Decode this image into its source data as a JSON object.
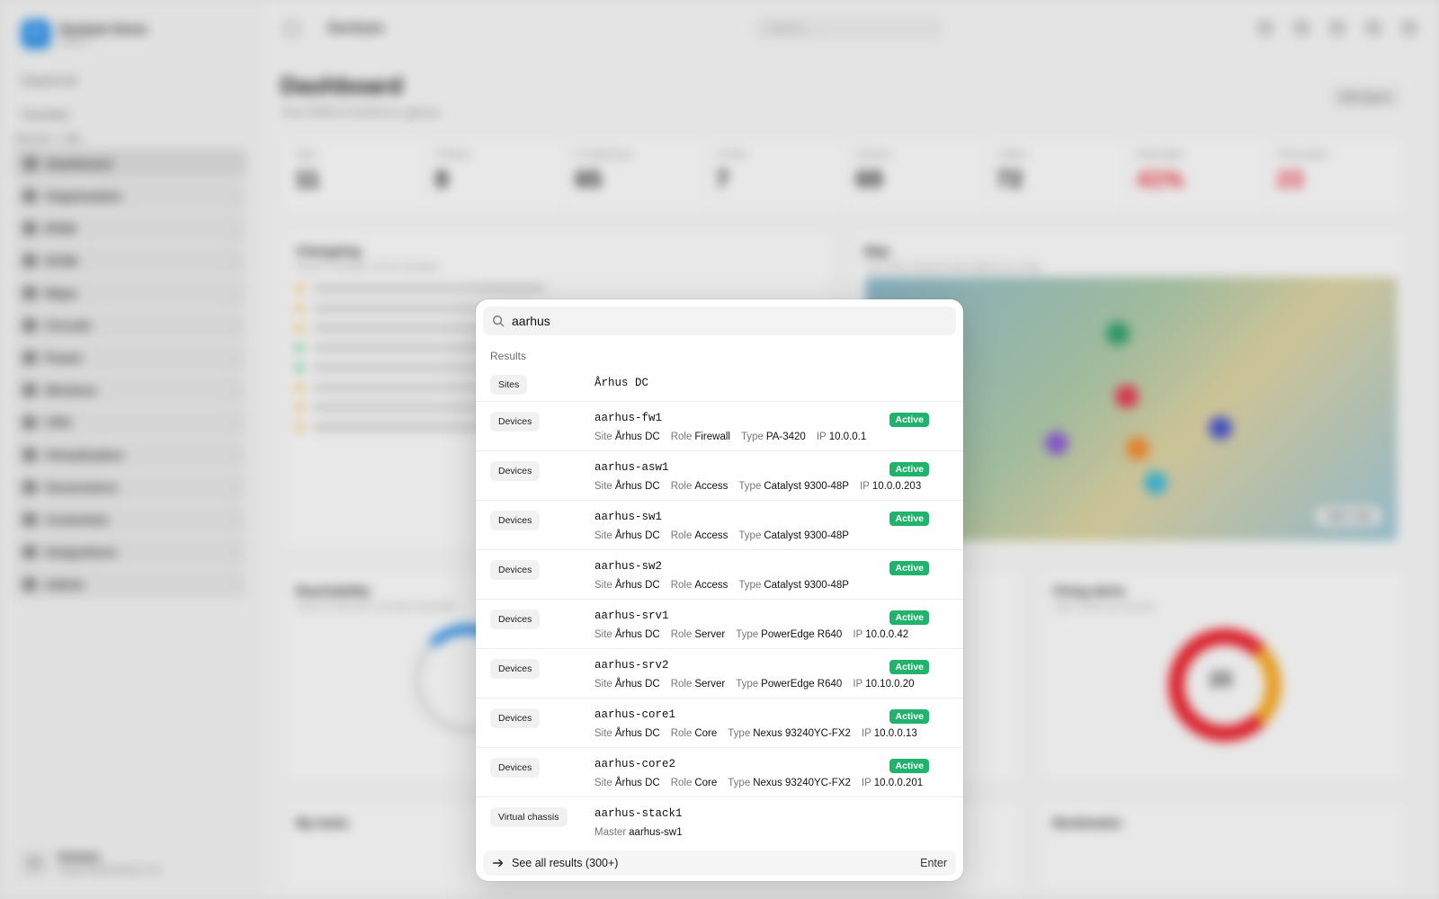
{
  "app": {
    "brand_name": "Danbyte Demo",
    "brand_sub": "Admin",
    "brand_initial": "D",
    "topbar_title": "Danbyte",
    "search_placeholder": "Search...",
    "util_expand": "Expand all",
    "util_favorites": "Favorites",
    "section_label": "Devices · Edit",
    "nav": [
      "Dashboard",
      "Organization",
      "IPAM",
      "DCIM",
      "Maps",
      "Circuits",
      "Power",
      "Wireless",
      "VPN",
      "Virtualization",
      "Governance",
      "Customize",
      "Integrations",
      "Admin"
    ],
    "user_name": "Danbyte",
    "user_email": "support@danbyte.net",
    "user_initials": "DA",
    "page_title": "Dashboard",
    "page_sub": "Your IPAM & DCIM at a glance.",
    "edit_label": "Edit layout",
    "stats": [
      {
        "label": "Sites",
        "value": "11"
      },
      {
        "label": "Prefixes",
        "value": "8"
      },
      {
        "label": "IP addresses",
        "value": "65"
      },
      {
        "label": "VLANs",
        "value": "7"
      },
      {
        "label": "Devices",
        "value": "69"
      },
      {
        "label": "Cables",
        "value": "72"
      },
      {
        "label": "Reachable",
        "value": "41%"
      },
      {
        "label": "Firing alerts",
        "value": "23"
      }
    ],
    "changelog_title": "Changelog",
    "changelog_sub": "Recent changes across Danbyte",
    "map_title": "Map",
    "map_sub": "Your sites, devices and cables on a map",
    "map_btn": "Open map",
    "reach_title": "Reachability",
    "reach_sub": "Share of devices currently reachable",
    "alerts_title": "Firing alerts",
    "alerts_sub": "Open alerts by severity",
    "alerts_center": "23",
    "tasks_title": "My tasks",
    "bookmarks_title": "Bookmarks"
  },
  "palette": {
    "query": "aarhus",
    "group_label": "Results",
    "results": [
      {
        "badge": "Sites",
        "name": "Århus DC"
      },
      {
        "badge": "Devices",
        "name": "aarhus-fw1",
        "status": "Active",
        "meta": [
          {
            "k": "Site",
            "v": "Århus DC"
          },
          {
            "k": "Role",
            "v": "Firewall"
          },
          {
            "k": "Type",
            "v": "PA-3420"
          },
          {
            "k": "IP",
            "v": "10.0.0.1"
          }
        ]
      },
      {
        "badge": "Devices",
        "name": "aarhus-asw1",
        "status": "Active",
        "meta": [
          {
            "k": "Site",
            "v": "Århus DC"
          },
          {
            "k": "Role",
            "v": "Access"
          },
          {
            "k": "Type",
            "v": "Catalyst 9300-48P"
          },
          {
            "k": "IP",
            "v": "10.0.0.203"
          }
        ]
      },
      {
        "badge": "Devices",
        "name": "aarhus-sw1",
        "status": "Active",
        "meta": [
          {
            "k": "Site",
            "v": "Århus DC"
          },
          {
            "k": "Role",
            "v": "Access"
          },
          {
            "k": "Type",
            "v": "Catalyst 9300-48P"
          }
        ]
      },
      {
        "badge": "Devices",
        "name": "aarhus-sw2",
        "status": "Active",
        "meta": [
          {
            "k": "Site",
            "v": "Århus DC"
          },
          {
            "k": "Role",
            "v": "Access"
          },
          {
            "k": "Type",
            "v": "Catalyst 9300-48P"
          }
        ]
      },
      {
        "badge": "Devices",
        "name": "aarhus-srv1",
        "status": "Active",
        "meta": [
          {
            "k": "Site",
            "v": "Århus DC"
          },
          {
            "k": "Role",
            "v": "Server"
          },
          {
            "k": "Type",
            "v": "PowerEdge R640"
          },
          {
            "k": "IP",
            "v": "10.0.0.42"
          }
        ]
      },
      {
        "badge": "Devices",
        "name": "aarhus-srv2",
        "status": "Active",
        "meta": [
          {
            "k": "Site",
            "v": "Århus DC"
          },
          {
            "k": "Role",
            "v": "Server"
          },
          {
            "k": "Type",
            "v": "PowerEdge R640"
          },
          {
            "k": "IP",
            "v": "10.10.0.20"
          }
        ]
      },
      {
        "badge": "Devices",
        "name": "aarhus-core1",
        "status": "Active",
        "meta": [
          {
            "k": "Site",
            "v": "Århus DC"
          },
          {
            "k": "Role",
            "v": "Core"
          },
          {
            "k": "Type",
            "v": "Nexus 93240YC-FX2"
          },
          {
            "k": "IP",
            "v": "10.0.0.13"
          }
        ]
      },
      {
        "badge": "Devices",
        "name": "aarhus-core2",
        "status": "Active",
        "meta": [
          {
            "k": "Site",
            "v": "Århus DC"
          },
          {
            "k": "Role",
            "v": "Core"
          },
          {
            "k": "Type",
            "v": "Nexus 93240YC-FX2"
          },
          {
            "k": "IP",
            "v": "10.0.0.201"
          }
        ]
      },
      {
        "badge": "Virtual chassis",
        "name": "aarhus-stack1",
        "meta": [
          {
            "k": "Master",
            "v": "aarhus-sw1"
          }
        ]
      }
    ],
    "footer_label": "See all results (300+)",
    "footer_key": "Enter"
  },
  "icons": {
    "search": "search-icon",
    "arrow": "arrow-right-icon"
  },
  "colors": {
    "active_badge": "#1fb36b",
    "brand": "#1e88e5",
    "alert_red": "#e8212b"
  }
}
